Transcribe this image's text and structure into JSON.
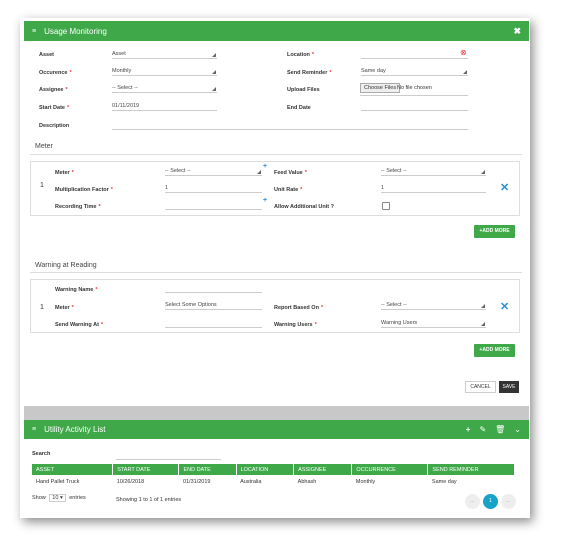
{
  "modal": {
    "title": "Usage Monitoring",
    "fields": {
      "asset": {
        "label": "Asset",
        "value": "Asset"
      },
      "location": {
        "label": "Location",
        "value": ""
      },
      "occurence": {
        "label": "Occurence",
        "value": "Monthly"
      },
      "send_reminder": {
        "label": "Send Reminder",
        "value": "Same day"
      },
      "assignee": {
        "label": "Assignee",
        "value": "-- Select --"
      },
      "upload_files": {
        "label": "Upload Files",
        "button": "Choose Files",
        "status": "No file chosen"
      },
      "start_date": {
        "label": "Start Date",
        "value": "01/11/2019"
      },
      "end_date": {
        "label": "End Date",
        "value": ""
      },
      "description": {
        "label": "Description",
        "value": ""
      }
    },
    "meter_section": {
      "title": "Meter",
      "row_index": "1",
      "meter": {
        "label": "Meter",
        "value": "-- Select --"
      },
      "feed_value": {
        "label": "Feed Value",
        "value": "-- Select --"
      },
      "multiplication_factor": {
        "label": "Multiplication Factor",
        "value": "1"
      },
      "unit_rate": {
        "label": "Unit Rate",
        "value": "1"
      },
      "recording_time": {
        "label": "Recording Time",
        "value": ""
      },
      "allow_additional_unit": {
        "label": "Allow Additional Unit ?",
        "checked": false
      },
      "add_more": "+ADD MORE"
    },
    "warning_section": {
      "title": "Warning at Reading",
      "row_index": "1",
      "warning_name": {
        "label": "Warning Name",
        "value": ""
      },
      "meter": {
        "label": "Meter",
        "value": "Select Some Options"
      },
      "report_based_on": {
        "label": "Report Based On",
        "value": "-- Select --"
      },
      "send_warning_at": {
        "label": "Send Warning At",
        "value": ""
      },
      "warning_users": {
        "label": "Warning Users",
        "value": "Warning Users"
      },
      "add_more": "+ADD MORE"
    },
    "cancel": "CANCEL",
    "save": "SAVE"
  },
  "list": {
    "title": "Utility Activity List",
    "search_label": "Search",
    "columns": [
      "ASSET",
      "START DATE",
      "END DATE",
      "LOCATION",
      "ASSIGNEE",
      "OCCURRENCE",
      "SEND REMINDER"
    ],
    "rows": [
      [
        "Hand Pallet Truck",
        "10/26/2018",
        "01/31/2019",
        "Australia",
        "Abhash",
        "Monthly",
        "Same day"
      ]
    ],
    "show_label": "Show",
    "page_size": "10",
    "entries_label": "entries",
    "info": "Showing 1 to 1 of 1 entries",
    "pagination": {
      "prev": "...",
      "current": "1",
      "next": "..."
    }
  },
  "colors": {
    "accent": "#3fa94a",
    "link": "#2a8fd6",
    "required": "#e33333"
  }
}
